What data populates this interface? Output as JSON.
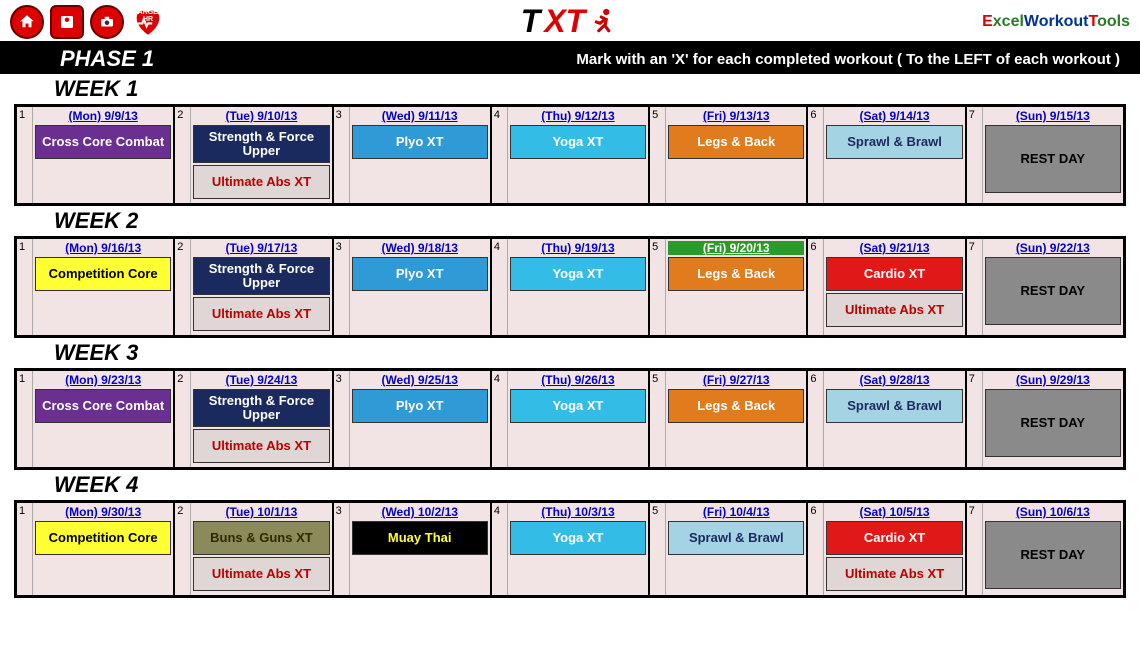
{
  "header": {
    "heart_label": "TARGET HR",
    "logo_t": "T",
    "logo_xt": "XT",
    "brand": {
      "e": "E",
      "xcel": "xcel",
      "w": "W",
      "orkout": "orkout",
      "t": "T",
      "ools": "ools"
    }
  },
  "phase": {
    "title": "PHASE 1",
    "instruction": "Mark with an 'X' for each completed workout ( To the LEFT of each workout )"
  },
  "workout_types": {
    "crosscore": "Cross Core Combat",
    "strength": "Strength & Force Upper",
    "ultimate": "Ultimate Abs XT",
    "plyo": "Plyo XT",
    "yoga": "Yoga XT",
    "legs": "Legs & Back",
    "sprawl": "Sprawl & Brawl",
    "rest": "REST DAY",
    "comp": "Competition Core",
    "cardio": "Cardio XT",
    "buns": "Buns & Guns XT",
    "muay": "Muay Thai"
  },
  "weeks": [
    {
      "label": "WEEK 1",
      "days": [
        {
          "n": "1",
          "date": "(Mon) 9/9/13",
          "w": [
            "crosscore"
          ]
        },
        {
          "n": "2",
          "date": "(Tue) 9/10/13",
          "w": [
            "strength",
            "ultimate"
          ]
        },
        {
          "n": "3",
          "date": "(Wed) 9/11/13",
          "w": [
            "plyo"
          ]
        },
        {
          "n": "4",
          "date": "(Thu) 9/12/13",
          "w": [
            "yoga"
          ]
        },
        {
          "n": "5",
          "date": "(Fri) 9/13/13",
          "w": [
            "legs"
          ]
        },
        {
          "n": "6",
          "date": "(Sat) 9/14/13",
          "w": [
            "sprawl"
          ]
        },
        {
          "n": "7",
          "date": "(Sun) 9/15/13",
          "w": [
            "rest"
          ],
          "rest": true
        }
      ]
    },
    {
      "label": "WEEK 2",
      "days": [
        {
          "n": "1",
          "date": "(Mon) 9/16/13",
          "w": [
            "comp"
          ]
        },
        {
          "n": "2",
          "date": "(Tue) 9/17/13",
          "w": [
            "strength",
            "ultimate"
          ]
        },
        {
          "n": "3",
          "date": "(Wed) 9/18/13",
          "w": [
            "plyo"
          ]
        },
        {
          "n": "4",
          "date": "(Thu) 9/19/13",
          "w": [
            "yoga"
          ]
        },
        {
          "n": "5",
          "date": "(Fri) 9/20/13",
          "w": [
            "legs"
          ],
          "hilite": true
        },
        {
          "n": "6",
          "date": "(Sat) 9/21/13",
          "w": [
            "cardio",
            "ultimate"
          ]
        },
        {
          "n": "7",
          "date": "(Sun) 9/22/13",
          "w": [
            "rest"
          ],
          "rest": true
        }
      ]
    },
    {
      "label": "WEEK 3",
      "days": [
        {
          "n": "1",
          "date": "(Mon) 9/23/13",
          "w": [
            "crosscore"
          ]
        },
        {
          "n": "2",
          "date": "(Tue) 9/24/13",
          "w": [
            "strength",
            "ultimate"
          ]
        },
        {
          "n": "3",
          "date": "(Wed) 9/25/13",
          "w": [
            "plyo"
          ]
        },
        {
          "n": "4",
          "date": "(Thu) 9/26/13",
          "w": [
            "yoga"
          ]
        },
        {
          "n": "5",
          "date": "(Fri) 9/27/13",
          "w": [
            "legs"
          ]
        },
        {
          "n": "6",
          "date": "(Sat) 9/28/13",
          "w": [
            "sprawl"
          ]
        },
        {
          "n": "7",
          "date": "(Sun) 9/29/13",
          "w": [
            "rest"
          ],
          "rest": true
        }
      ]
    },
    {
      "label": "WEEK 4",
      "days": [
        {
          "n": "1",
          "date": "(Mon) 9/30/13",
          "w": [
            "comp"
          ]
        },
        {
          "n": "2",
          "date": "(Tue) 10/1/13",
          "w": [
            "buns",
            "ultimate"
          ]
        },
        {
          "n": "3",
          "date": "(Wed) 10/2/13",
          "w": [
            "muay"
          ]
        },
        {
          "n": "4",
          "date": "(Thu) 10/3/13",
          "w": [
            "yoga"
          ]
        },
        {
          "n": "5",
          "date": "(Fri) 10/4/13",
          "w": [
            "sprawl"
          ]
        },
        {
          "n": "6",
          "date": "(Sat) 10/5/13",
          "w": [
            "cardio",
            "ultimate"
          ]
        },
        {
          "n": "7",
          "date": "(Sun) 10/6/13",
          "w": [
            "rest"
          ],
          "rest": true
        }
      ]
    }
  ]
}
